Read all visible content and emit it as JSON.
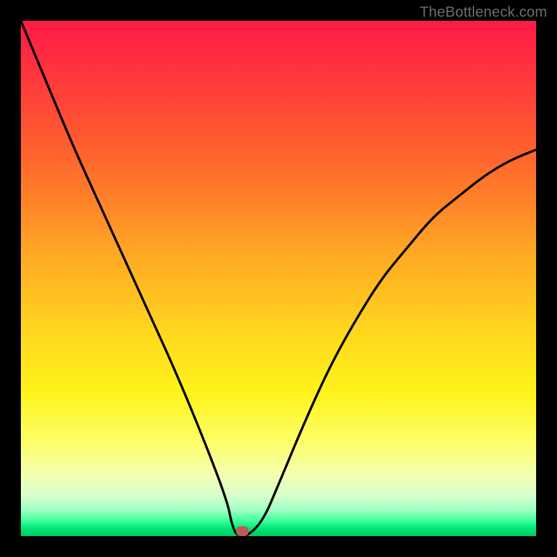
{
  "watermark": "TheBottleneck.com",
  "chart_data": {
    "type": "line",
    "title": "",
    "xlabel": "",
    "ylabel": "",
    "xlim": [
      0,
      100
    ],
    "ylim": [
      0,
      100
    ],
    "grid": false,
    "legend": false,
    "series": [
      {
        "name": "curve",
        "x": [
          0,
          5,
          10,
          15,
          20,
          25,
          30,
          35,
          40,
          41,
          42,
          44,
          47,
          50,
          55,
          60,
          65,
          70,
          75,
          80,
          85,
          90,
          95,
          100
        ],
        "y": [
          100,
          88,
          76,
          65,
          54,
          43,
          32,
          20,
          7,
          2,
          0,
          0,
          3,
          10,
          22,
          33,
          42,
          50,
          56,
          62,
          66,
          70,
          73,
          75
        ]
      }
    ],
    "marker": {
      "x": 43,
      "y": 1
    },
    "gradient_colors": {
      "top": "#ff1a48",
      "mid_upper": "#ffa724",
      "mid": "#fff31a",
      "mid_lower": "#d9ffca",
      "bottom": "#00c85f"
    }
  }
}
